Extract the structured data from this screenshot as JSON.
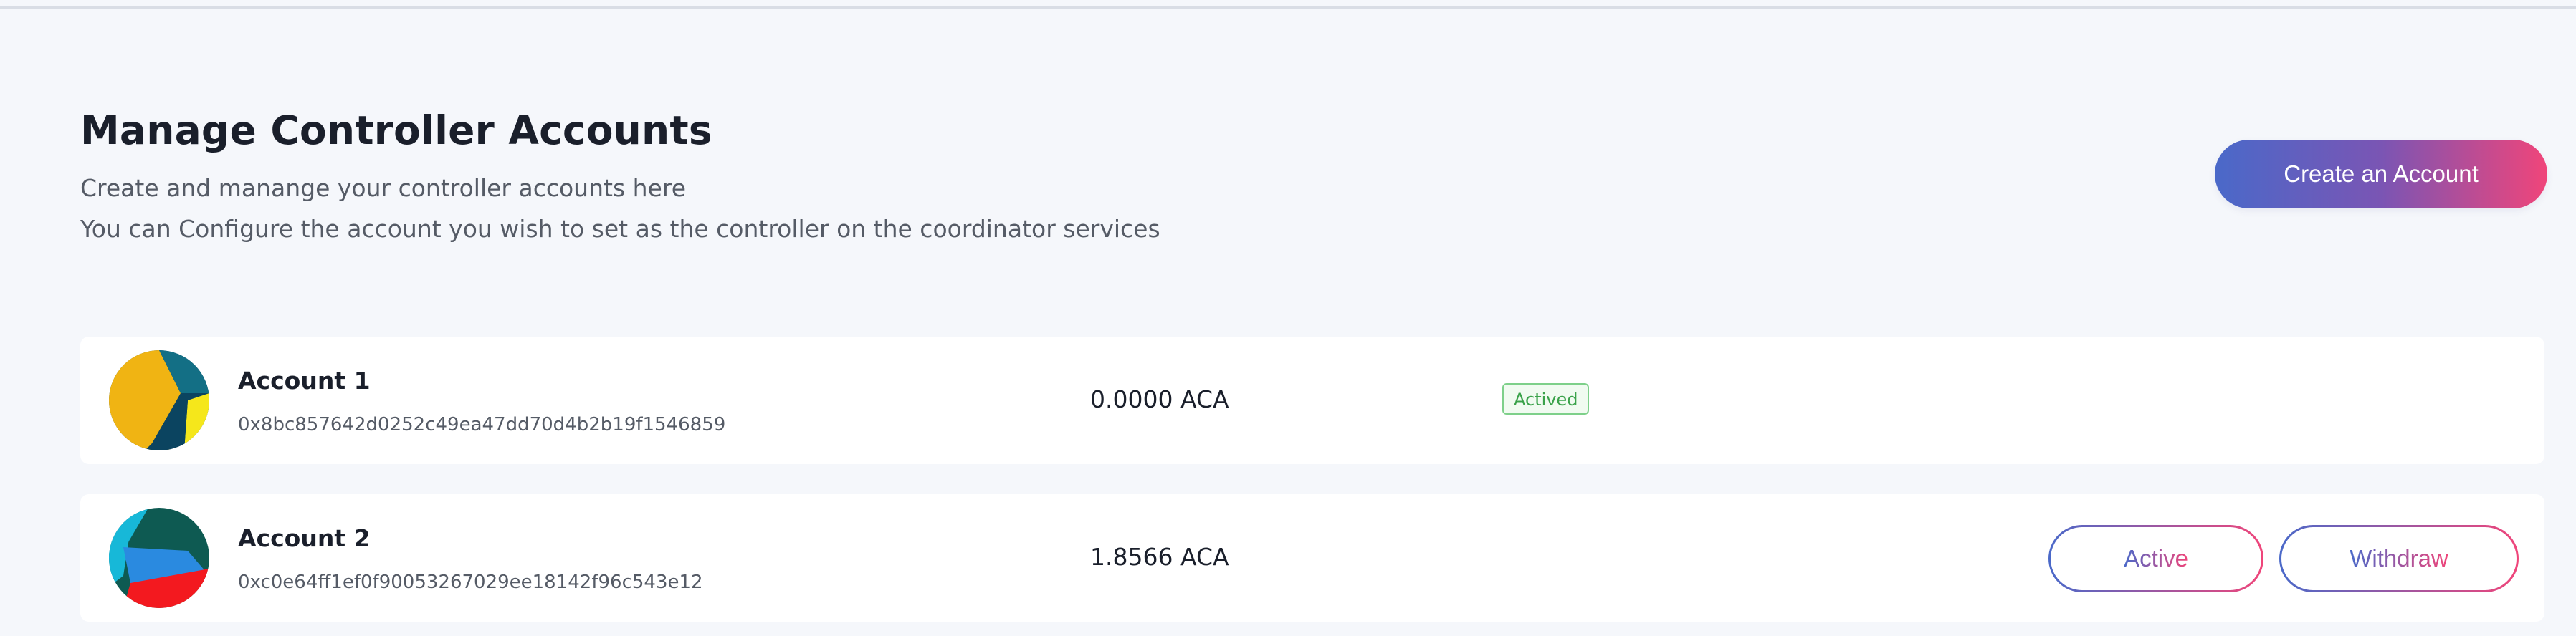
{
  "header": {
    "title": "Manage Controller Accounts",
    "description_line1": "Create and manange your controller accounts here",
    "description_line2": "You can Configure the account you wish to set as the controller on the coordinator services",
    "create_button_label": "Create an Account"
  },
  "accounts": [
    {
      "name": "Account 1",
      "address": "0x8bc857642d0252c49ea47dd70d4b2b19f1546859",
      "balance": "0.0000 ACA",
      "status_badge": "Actived",
      "avatar_colors": [
        "#f0b413",
        "#0b4460",
        "#136f85",
        "#f5e71b"
      ]
    },
    {
      "name": "Account 2",
      "address": "0xc0e64ff1ef0f90053267029ee18142f96c543e12",
      "balance": "1.8566 ACA",
      "active_button_label": "Active",
      "withdraw_button_label": "Withdraw",
      "avatar_colors": [
        "#0e5a52",
        "#2a8ae0",
        "#f3191f",
        "#17b8d8"
      ]
    }
  ],
  "colors": {
    "background": "#f5f7fb",
    "gradient_start": "#4a69c9",
    "gradient_end": "#f0457a",
    "badge_green": "#3aa24a"
  }
}
